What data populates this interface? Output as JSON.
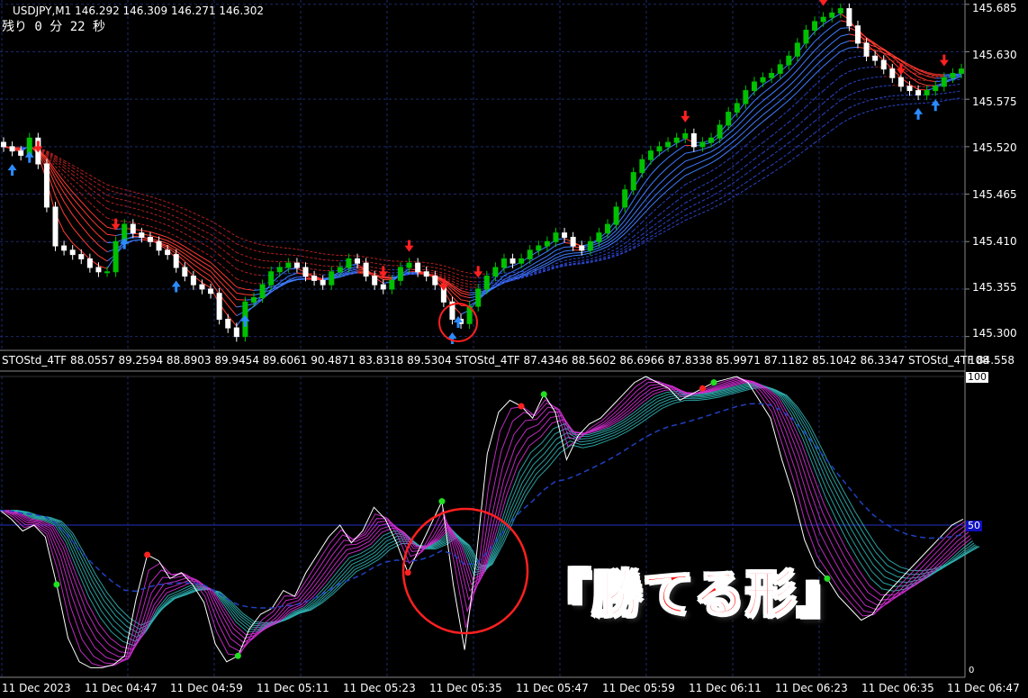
{
  "header": {
    "symbol_line": "USDJPY,M1  146.292 146.309 146.271 146.302",
    "countdown": "残り 0 分 22 秒"
  },
  "subwindow": {
    "header": "STOStd_4TF 88.0557 89.2594 88.8903 89.9454 89.6061 90.4871 83.8318 89.5304   STOStd_4TF 87.4346 88.5602 86.6966 87.8338 85.9971 87.1182 85.1042 86.3347   STOStd_4TF 84.558",
    "scale_max": "108",
    "level_100": "100",
    "level_50": "50",
    "scale_min": "0"
  },
  "price_axis": [
    "145.685",
    "145.630",
    "145.575",
    "145.520",
    "145.465",
    "145.410",
    "145.355",
    "145.300"
  ],
  "time_axis": [
    "11 Dec 2023",
    "11 Dec 04:47",
    "11 Dec 04:59",
    "11 Dec 05:11",
    "11 Dec 05:23",
    "11 Dec 05:35",
    "11 Dec 05:47",
    "11 Dec 05:59",
    "11 Dec 06:11",
    "11 Dec 06:23",
    "11 Dec 06:35",
    "11 Dec 06:47"
  ],
  "caption": "『勝てる形』",
  "colors": {
    "background": "#000000",
    "grid": "#1c2a6b",
    "bull_candle": "#00c000",
    "bear_candle": "#ffffff",
    "down_arrow": "#ff2020",
    "up_arrow": "#2a8cff",
    "sto_fast": "#ffffff",
    "sto_magenta": "#d22fd2",
    "sto_teal": "#2fb0b0",
    "highlight_circle": "#ff2020",
    "level_line": "#2030c0"
  },
  "chart_data": [
    {
      "type": "candlestick",
      "symbol": "USDJPY,M1",
      "ylim": [
        145.285,
        145.69
      ],
      "yticks": [
        145.685,
        145.63,
        145.575,
        145.52,
        145.465,
        145.41,
        145.355,
        145.3
      ],
      "close_path": [
        145.52,
        145.515,
        145.51,
        145.53,
        145.5,
        145.45,
        145.405,
        145.4,
        145.395,
        145.39,
        145.38,
        145.375,
        145.375,
        145.41,
        145.43,
        145.42,
        145.415,
        145.41,
        145.4,
        145.395,
        145.38,
        145.37,
        145.36,
        145.355,
        145.35,
        145.32,
        145.31,
        145.3,
        145.34,
        145.345,
        145.36,
        145.375,
        145.38,
        145.385,
        145.38,
        145.37,
        145.365,
        145.36,
        145.375,
        145.38,
        145.39,
        145.385,
        145.37,
        145.36,
        145.355,
        145.365,
        145.38,
        145.385,
        145.375,
        145.37,
        145.36,
        145.34,
        145.32,
        145.315,
        145.335,
        145.355,
        145.37,
        145.38,
        145.39,
        145.385,
        145.39,
        145.4,
        145.405,
        145.41,
        145.42,
        145.415,
        145.405,
        145.4,
        145.41,
        145.42,
        145.43,
        145.45,
        145.47,
        145.49,
        145.505,
        145.515,
        145.52,
        145.525,
        145.53,
        145.535,
        145.52,
        145.525,
        145.53,
        145.545,
        145.56,
        145.57,
        145.585,
        145.595,
        145.6,
        145.605,
        145.615,
        145.625,
        145.64,
        145.655,
        145.665,
        145.67,
        145.675,
        145.68,
        145.66,
        145.64,
        145.625,
        145.62,
        145.61,
        145.6,
        145.59,
        145.585,
        145.58,
        145.585,
        145.59,
        145.6,
        145.605,
        145.61
      ]
    },
    {
      "type": "line",
      "name": "STOStd_4TF",
      "ylim": [
        0,
        108
      ],
      "levels": [
        100,
        50
      ],
      "fast_line": [
        55,
        52,
        48,
        50,
        46,
        30,
        12,
        4,
        2,
        2,
        3,
        6,
        25,
        40,
        38,
        32,
        34,
        30,
        24,
        10,
        4,
        6,
        15,
        20,
        22,
        28,
        26,
        34,
        40,
        46,
        50,
        44,
        48,
        56,
        52,
        44,
        34,
        42,
        50,
        58,
        30,
        8,
        38,
        74,
        88,
        92,
        90,
        86,
        94,
        88,
        72,
        80,
        84,
        86,
        90,
        94,
        98,
        100,
        98,
        96,
        92,
        94,
        96,
        98,
        99,
        100,
        98,
        92,
        86,
        72,
        60,
        45,
        36,
        32,
        26,
        22,
        18,
        20,
        26,
        30,
        34,
        38,
        42,
        46,
        50,
        52
      ]
    }
  ]
}
